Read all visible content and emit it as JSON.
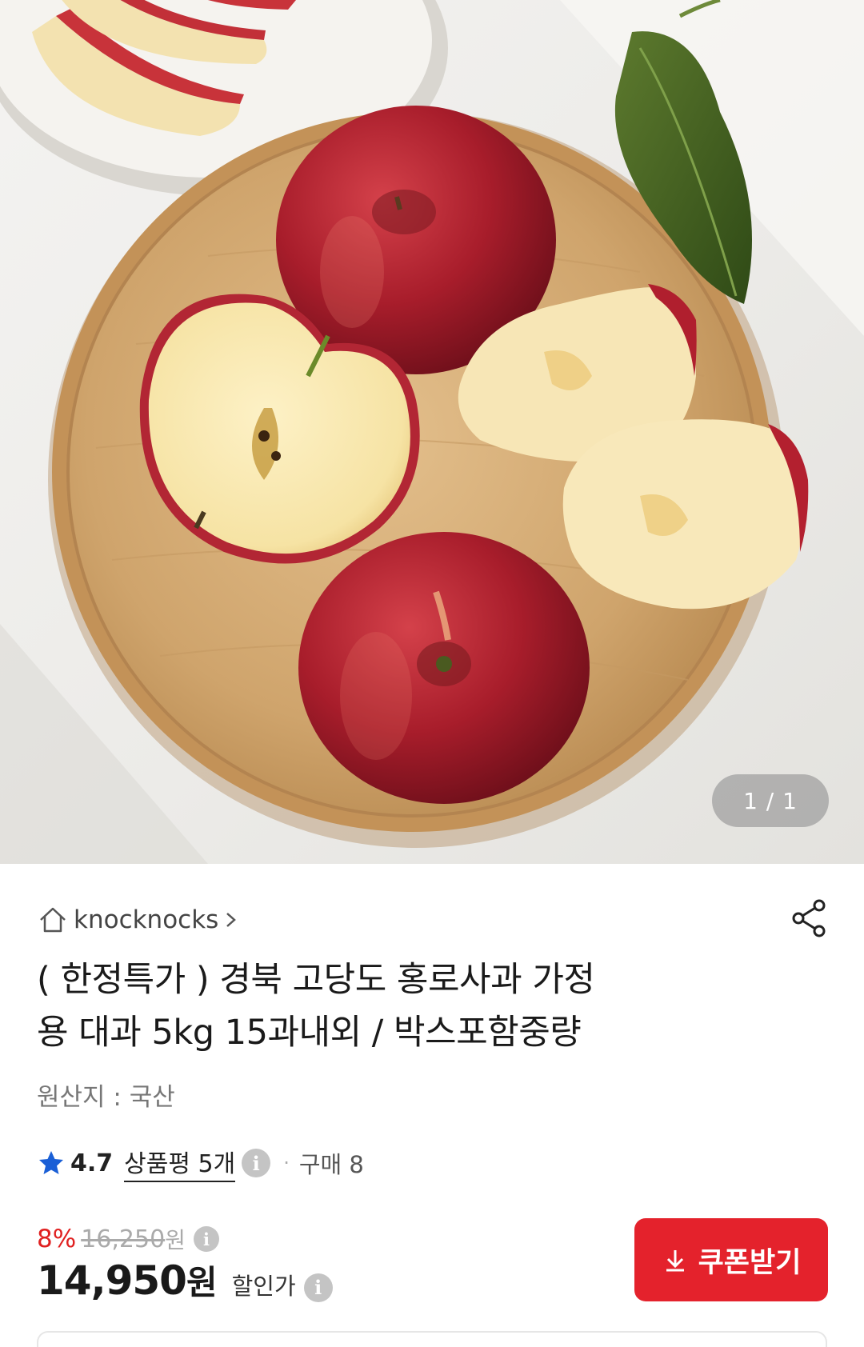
{
  "gallery": {
    "current": "1",
    "total": "1",
    "pager_text": "1 / 1"
  },
  "seller": {
    "name": "knocknocks",
    "home_icon": "home-icon",
    "chevron_icon": "chevron-right-icon"
  },
  "share_icon": "share-icon",
  "product": {
    "title_line1": "( 한정특가 ) 경북 고당도 홍로사과 가정",
    "title_line2": "용 대과 5kg 15과내외 / 박스포함중량",
    "origin": "원산지 : 국산"
  },
  "rating": {
    "score": "4.7",
    "reviews_label": "상품평 5개",
    "separator": "·",
    "purchase_label": "구매 8",
    "star_color": "#1a5fd6"
  },
  "price": {
    "discount_percent": "8%",
    "original_price": "16,250",
    "original_unit": "원",
    "sale_price": "14,950",
    "sale_unit": "원",
    "sale_label": "할인가",
    "discount_color": "#e02020"
  },
  "coupon": {
    "label": "쿠폰받기",
    "icon": "download-arrow-icon",
    "color": "#e4222c"
  }
}
